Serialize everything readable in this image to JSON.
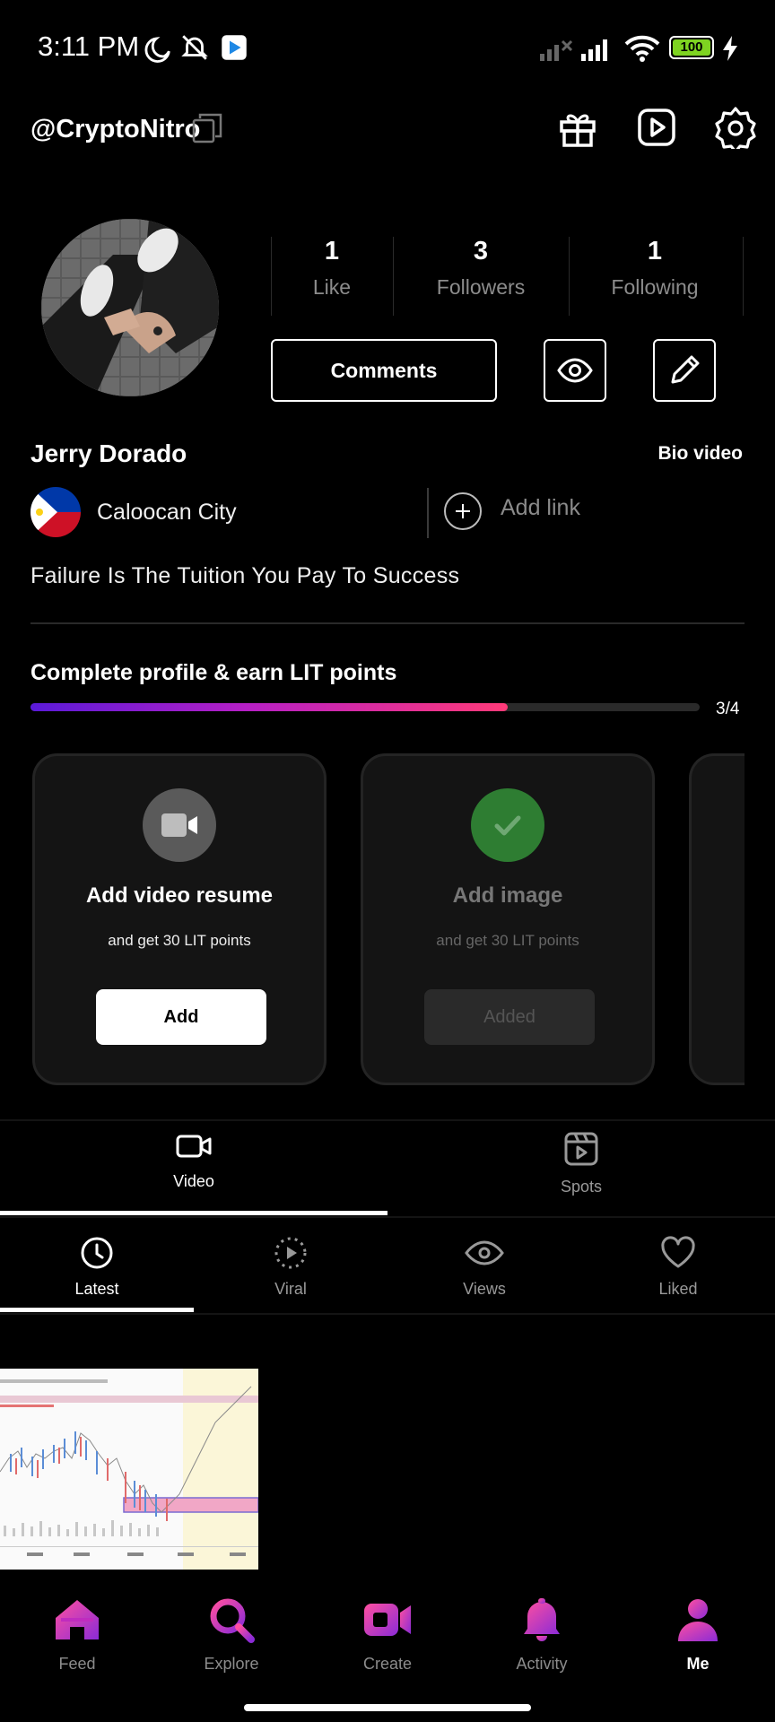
{
  "status_bar": {
    "time": "3:11 PM",
    "battery": "100"
  },
  "header": {
    "username": "@CryptoNitro"
  },
  "stats": [
    {
      "value": "1",
      "label": "Like"
    },
    {
      "value": "3",
      "label": "Followers"
    },
    {
      "value": "1",
      "label": "Following"
    }
  ],
  "actions": {
    "comments_label": "Comments"
  },
  "profile": {
    "name": "Jerry Dorado",
    "bio_video_label": "Bio video",
    "city": "Caloocan City",
    "add_link_label": "Add link",
    "tagline": "Failure Is The Tuition You Pay To Success"
  },
  "completion": {
    "title": "Complete profile & earn LIT points",
    "progress_text": "3/4",
    "progress_fraction": 0.75,
    "cards": [
      {
        "title": "Add video resume",
        "subtitle": "and get 30 LIT points",
        "button": "Add",
        "done": false
      },
      {
        "title": "Add image",
        "subtitle": "and get 30 LIT points",
        "button": "Added",
        "done": true
      }
    ]
  },
  "content_tabs": [
    {
      "label": "Video",
      "active": true
    },
    {
      "label": "Spots",
      "active": false
    }
  ],
  "sort_tabs": [
    {
      "label": "Latest",
      "active": true
    },
    {
      "label": "Viral",
      "active": false
    },
    {
      "label": "Views",
      "active": false
    },
    {
      "label": "Liked",
      "active": false
    }
  ],
  "bottom_nav": [
    {
      "label": "Feed",
      "icon": "home-icon"
    },
    {
      "label": "Explore",
      "icon": "search-icon"
    },
    {
      "label": "Create",
      "icon": "video-camera-icon"
    },
    {
      "label": "Activity",
      "icon": "bell-icon"
    },
    {
      "label": "Me",
      "icon": "person-icon",
      "active": true
    }
  ],
  "colors": {
    "accent_start": "#5a1ad8",
    "accent_end": "#ff3a78",
    "nav_pink": "#e040c8",
    "check_green": "#2e7d32"
  }
}
